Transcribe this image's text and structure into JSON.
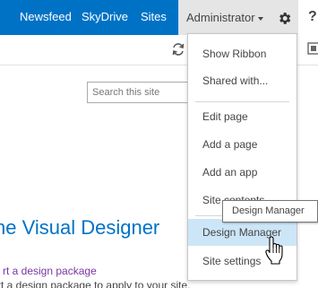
{
  "suitebar": {
    "links": {
      "newsfeed": "Newsfeed",
      "skydrive": "SkyDrive",
      "sites": "Sites"
    },
    "user_menu_label": "Administrator",
    "accent_color": "#0072c6",
    "settings_icon": "gear-icon",
    "help_icon": "help-icon",
    "help_glyph": "?"
  },
  "ribbon": {
    "sync_icon": "sync-icon",
    "focus_icon": "focus-on-content-icon"
  },
  "search": {
    "placeholder": "Search this site"
  },
  "settings_menu": {
    "items": [
      "Show Ribbon",
      "Shared with...",
      "Edit page",
      "Add a page",
      "Add an app",
      "Site contents",
      "Design Manager",
      "Site settings"
    ],
    "hovered_item": "Design Manager"
  },
  "tooltip": {
    "text": "Design Manager"
  },
  "main": {
    "heading": "he Visual Designer",
    "link": "rt a design package",
    "description": "rt a design package to apply to your site."
  }
}
